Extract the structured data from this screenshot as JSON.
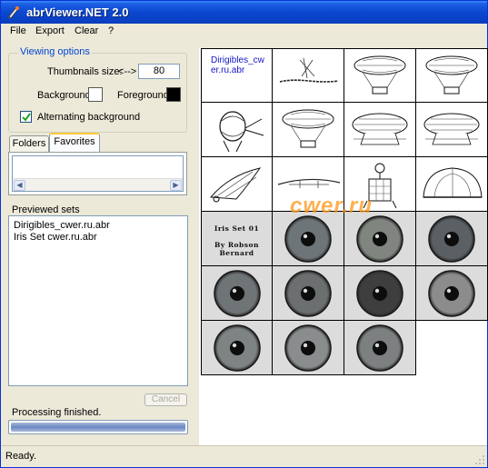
{
  "window": {
    "title": "abrViewer.NET 2.0"
  },
  "menu": [
    "File",
    "Export",
    "Clear",
    "?"
  ],
  "viewing_options": {
    "legend": "Viewing options",
    "thumbnails_label": "Thumbnails size:",
    "arrow_label": "<-->",
    "thumbnails_value": "80",
    "background_label": "Background:",
    "background_color": "#ffffff",
    "foreground_label": "Foreground:",
    "foreground_color": "#000000",
    "alternating_label": "Alternating background",
    "alternating_checked": true
  },
  "tabs": [
    {
      "label": "Folders",
      "active": false
    },
    {
      "label": "Favorites",
      "active": true
    }
  ],
  "previewed": {
    "label": "Previewed sets",
    "items": [
      "Dirigibles_cwer.ru.abr",
      "Iris Set cwer.ru.abr"
    ]
  },
  "cancel_label": "Cancel",
  "processing_text": "Processing finished.",
  "progress": 1.0,
  "status": "Ready.",
  "grid": {
    "first_caption": "Dirigibles_cwer.ru.abr",
    "iris_title_line1": "Iris Set 01",
    "iris_title_line2": "By Robson Bernard",
    "watermark": "cwer.ru",
    "cells": [
      {
        "type": "caption"
      },
      {
        "type": "sketch",
        "icon": "scribble-text"
      },
      {
        "type": "sketch",
        "icon": "balloon-airship"
      },
      {
        "type": "sketch",
        "icon": "balloon-airship"
      },
      {
        "type": "sketch",
        "icon": "ornate-machine"
      },
      {
        "type": "sketch",
        "icon": "balloon-airship"
      },
      {
        "type": "sketch",
        "icon": "zeppelin"
      },
      {
        "type": "sketch",
        "icon": "zeppelin"
      },
      {
        "type": "sketch",
        "icon": "winged-ship"
      },
      {
        "type": "sketch",
        "icon": "flying-machine"
      },
      {
        "type": "sketch",
        "icon": "diver-balloon"
      },
      {
        "type": "sketch",
        "icon": "dome-airship"
      },
      {
        "type": "iris-title"
      },
      {
        "type": "iris",
        "shade": "#6e7578"
      },
      {
        "type": "iris",
        "shade": "#80857f"
      },
      {
        "type": "iris",
        "shade": "#5a6064"
      },
      {
        "type": "iris",
        "shade": "#6f7476"
      },
      {
        "type": "iris",
        "shade": "#6c6f70"
      },
      {
        "type": "iris",
        "shade": "#3e3e3f"
      },
      {
        "type": "iris",
        "shade": "#8c8c8c"
      },
      {
        "type": "iris",
        "shade": "#7e8384"
      },
      {
        "type": "iris",
        "shade": "#8a8d8e"
      },
      {
        "type": "iris",
        "shade": "#7d8080"
      }
    ]
  }
}
